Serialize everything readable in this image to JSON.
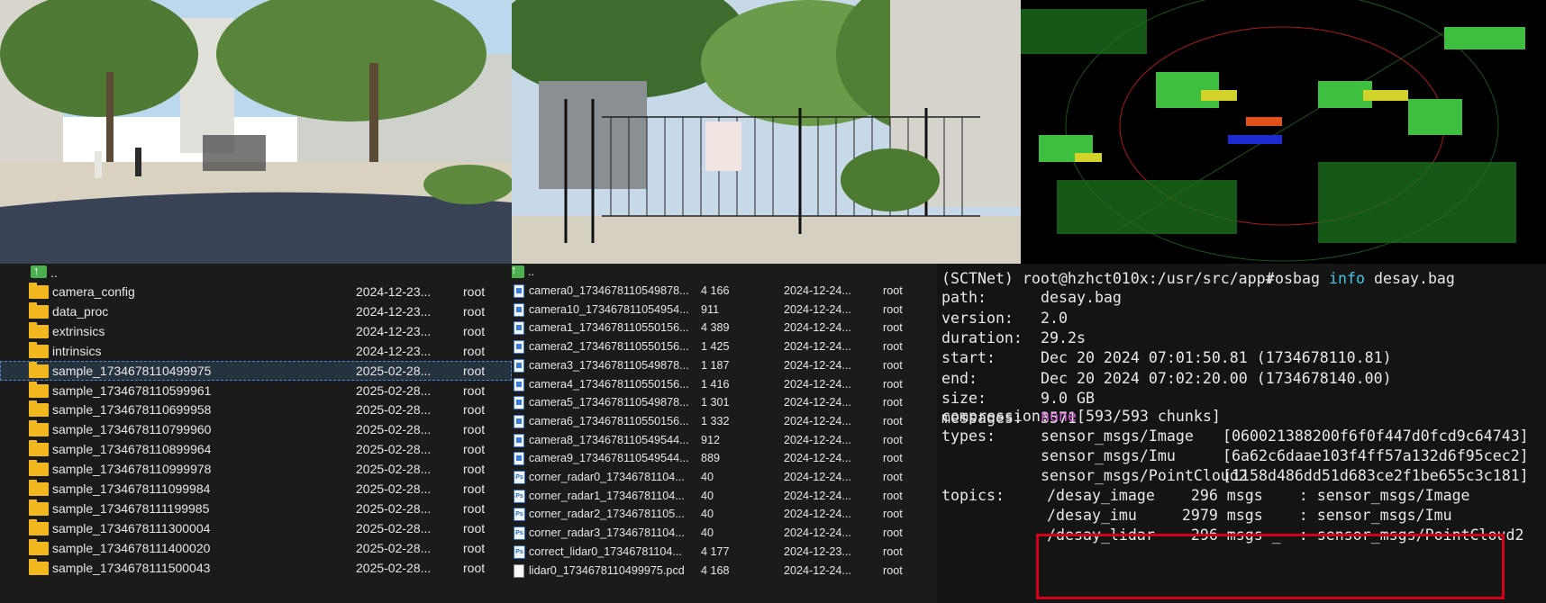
{
  "images": {
    "street": {
      "description_icon": "street-camera-image"
    },
    "gate": {
      "description_icon": "gate-camera-image"
    },
    "lidar": {
      "description_icon": "lidar-pointcloud-image"
    }
  },
  "left_pane": {
    "parent": "..",
    "rows": [
      {
        "name": "camera_config",
        "date": "2024-12-23...",
        "owner": "root"
      },
      {
        "name": "data_proc",
        "date": "2024-12-23...",
        "owner": "root"
      },
      {
        "name": "extrinsics",
        "date": "2024-12-23...",
        "owner": "root"
      },
      {
        "name": "intrinsics",
        "date": "2024-12-23...",
        "owner": "root"
      },
      {
        "name": "sample_1734678110499975",
        "date": "2025-02-28...",
        "owner": "root"
      },
      {
        "name": "sample_1734678110599961",
        "date": "2025-02-28...",
        "owner": "root"
      },
      {
        "name": "sample_1734678110699958",
        "date": "2025-02-28...",
        "owner": "root"
      },
      {
        "name": "sample_1734678110799960",
        "date": "2025-02-28...",
        "owner": "root"
      },
      {
        "name": "sample_1734678110899964",
        "date": "2025-02-28...",
        "owner": "root"
      },
      {
        "name": "sample_1734678110999978",
        "date": "2025-02-28...",
        "owner": "root"
      },
      {
        "name": "sample_1734678111099984",
        "date": "2025-02-28...",
        "owner": "root"
      },
      {
        "name": "sample_1734678111199985",
        "date": "2025-02-28...",
        "owner": "root"
      },
      {
        "name": "sample_1734678111300004",
        "date": "2025-02-28...",
        "owner": "root"
      },
      {
        "name": "sample_1734678111400020",
        "date": "2025-02-28...",
        "owner": "root"
      },
      {
        "name": "sample_1734678111500043",
        "date": "2025-02-28...",
        "owner": "root"
      }
    ]
  },
  "mid_pane": {
    "parent": "..",
    "rows": [
      {
        "icon": "image",
        "name": "camera0_1734678110549878...",
        "size": "4 166",
        "date": "2024-12-24...",
        "owner": "root"
      },
      {
        "icon": "image",
        "name": "camera10_173467811054954...",
        "size": "911",
        "date": "2024-12-24...",
        "owner": "root"
      },
      {
        "icon": "image",
        "name": "camera1_1734678110550156...",
        "size": "4 389",
        "date": "2024-12-24...",
        "owner": "root"
      },
      {
        "icon": "image",
        "name": "camera2_1734678110550156...",
        "size": "1 425",
        "date": "2024-12-24...",
        "owner": "root"
      },
      {
        "icon": "image",
        "name": "camera3_1734678110549878...",
        "size": "1 187",
        "date": "2024-12-24...",
        "owner": "root"
      },
      {
        "icon": "image",
        "name": "camera4_1734678110550156...",
        "size": "1 416",
        "date": "2024-12-24...",
        "owner": "root"
      },
      {
        "icon": "image",
        "name": "camera5_1734678110549878...",
        "size": "1 301",
        "date": "2024-12-24...",
        "owner": "root"
      },
      {
        "icon": "image",
        "name": "camera6_1734678110550156...",
        "size": "1 332",
        "date": "2024-12-24...",
        "owner": "root"
      },
      {
        "icon": "image",
        "name": "camera8_1734678110549544...",
        "size": "912",
        "date": "2024-12-24...",
        "owner": "root"
      },
      {
        "icon": "image",
        "name": "camera9_1734678110549544...",
        "size": "889",
        "date": "2024-12-24...",
        "owner": "root"
      },
      {
        "icon": "ps",
        "name": "corner_radar0_17346781104...",
        "size": "40",
        "date": "2024-12-24...",
        "owner": "root"
      },
      {
        "icon": "ps",
        "name": "corner_radar1_17346781104...",
        "size": "40",
        "date": "2024-12-24...",
        "owner": "root"
      },
      {
        "icon": "ps",
        "name": "corner_radar2_17346781105...",
        "size": "40",
        "date": "2024-12-24...",
        "owner": "root"
      },
      {
        "icon": "ps",
        "name": "corner_radar3_17346781104...",
        "size": "40",
        "date": "2024-12-24...",
        "owner": "root"
      },
      {
        "icon": "ps",
        "name": "correct_lidar0_17346781104...",
        "size": "4 177",
        "date": "2024-12-23...",
        "owner": "root"
      },
      {
        "icon": "pcd",
        "name": "lidar0_1734678110499975.pcd",
        "size": "4 168",
        "date": "2024-12-24...",
        "owner": "root"
      }
    ]
  },
  "terminal": {
    "prompt": "(SCTNet) root@hzhct010x:/usr/src/app#",
    "cmd": "rosbag",
    "cmd_arg": "info",
    "cmd_file": "desay.bag",
    "fields": [
      {
        "key": "path:",
        "value": "desay.bag"
      },
      {
        "key": "version:",
        "value": "2.0"
      },
      {
        "key": "duration:",
        "value": "29.2s"
      },
      {
        "key": "start:",
        "value": "Dec 20 2024 07:01:50.81 (1734678110.81)"
      },
      {
        "key": "end:",
        "value": "Dec 20 2024 07:02:20.00 (1734678140.00)"
      },
      {
        "key": "size:",
        "value": "9.0 GB"
      },
      {
        "key": "messages:",
        "value": "3571"
      }
    ],
    "compression_key": "compression:",
    "compression_type": "none",
    "compression_rest": "[593/593 chunks]",
    "types_key": "types:",
    "types": [
      {
        "name": "sensor_msgs/Image      ",
        "hash": "[060021388200f6f0f447d0fcd9c64743]"
      },
      {
        "name": "sensor_msgs/Imu        ",
        "hash": "[6a62c6daae103f4ff57a132d6f95cec2]"
      },
      {
        "name": "sensor_msgs/PointCloud2",
        "hash": "[1158d486dd51d683ce2f1be655c3c181]"
      }
    ],
    "topics_key": "topics:",
    "topics": [
      {
        "line": "/desay_image    296 msgs    : sensor_msgs/Image"
      },
      {
        "line": "/desay_imu     2979 msgs    : sensor_msgs/Imu"
      },
      {
        "line": "/desay_lidar    296 msgs _  : sensor_msgs/PointCloud2"
      }
    ]
  },
  "colors": {
    "highlight": "#d6001c",
    "folder": "#f3b81f",
    "keyword": "#3fc6e8",
    "none": "#e060e0"
  }
}
